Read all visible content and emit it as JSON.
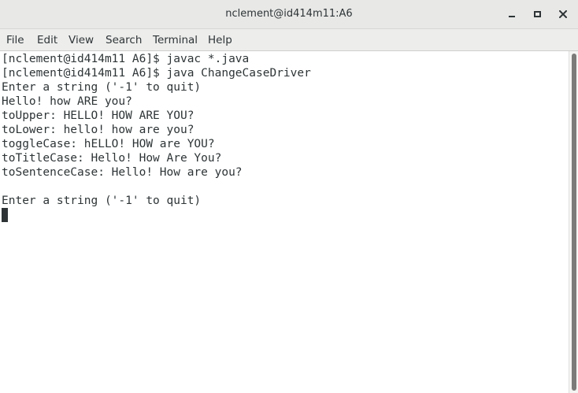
{
  "window": {
    "title": "nclement@id414m11:A6"
  },
  "menubar": {
    "items": [
      "File",
      "Edit",
      "View",
      "Search",
      "Terminal",
      "Help"
    ]
  },
  "terminal": {
    "lines": [
      "[nclement@id414m11 A6]$ javac *.java",
      "[nclement@id414m11 A6]$ java ChangeCaseDriver",
      "Enter a string ('-1' to quit)",
      "Hello! how ARE you?",
      "toUpper: HELLO! HOW ARE YOU?",
      "toLower: hello! how are you?",
      "toggleCase: hELLO! HOW are YOU?",
      "toTitleCase: Hello! How Are You?",
      "toSentenceCase: Hello! How are you?",
      "",
      "Enter a string ('-1' to quit)"
    ]
  },
  "icons": {
    "minimize": "minimize-icon",
    "maximize": "maximize-icon",
    "close": "close-icon"
  },
  "colors": {
    "titlebar": "#e8e8e7",
    "menubar": "#ededec",
    "terminal_bg": "#ffffff",
    "text": "#2e3436",
    "scrollbar_thumb": "#7b7b7a"
  }
}
